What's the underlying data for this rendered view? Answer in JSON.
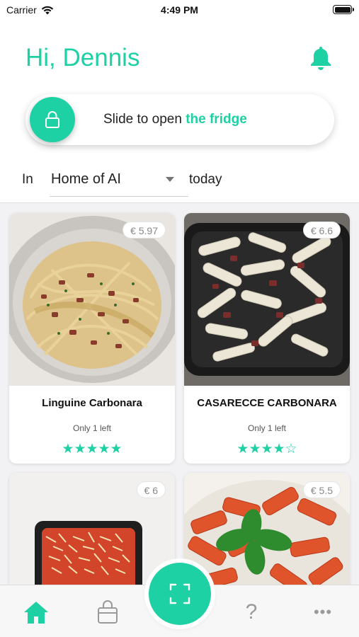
{
  "status_bar": {
    "carrier": "Carrier",
    "time": "4:49 PM"
  },
  "header": {
    "greeting": "Hi, Dennis"
  },
  "slider": {
    "text_prefix": "Slide to open ",
    "text_accent": "the fridge"
  },
  "location": {
    "prefix": "In",
    "selected": "Home of AI",
    "suffix": "today"
  },
  "products": [
    {
      "name": "Linguine Carbonara",
      "price": "€ 5.97",
      "stock": "Only 1 left",
      "stars": "★★★★★",
      "rating": 5
    },
    {
      "name": "CASARECCE CARBONARA",
      "price": "€ 6.6",
      "stock": "Only 1 left",
      "stars": "★★★★☆",
      "rating": 4
    },
    {
      "name": "",
      "price": "€ 6",
      "stock": "",
      "stars": ""
    },
    {
      "name": "",
      "price": "€ 5.5",
      "stock": "",
      "stars": ""
    }
  ],
  "tabs": [
    {
      "icon": "home-icon",
      "active": true
    },
    {
      "icon": "bag-icon",
      "active": false
    },
    {
      "icon": "scan-icon",
      "active": false
    },
    {
      "icon": "help-icon",
      "label": "?",
      "active": false
    },
    {
      "icon": "more-icon",
      "label": "•••",
      "active": false
    }
  ],
  "colors": {
    "accent": "#1ed1a4",
    "inactive": "#9a9a9a"
  }
}
